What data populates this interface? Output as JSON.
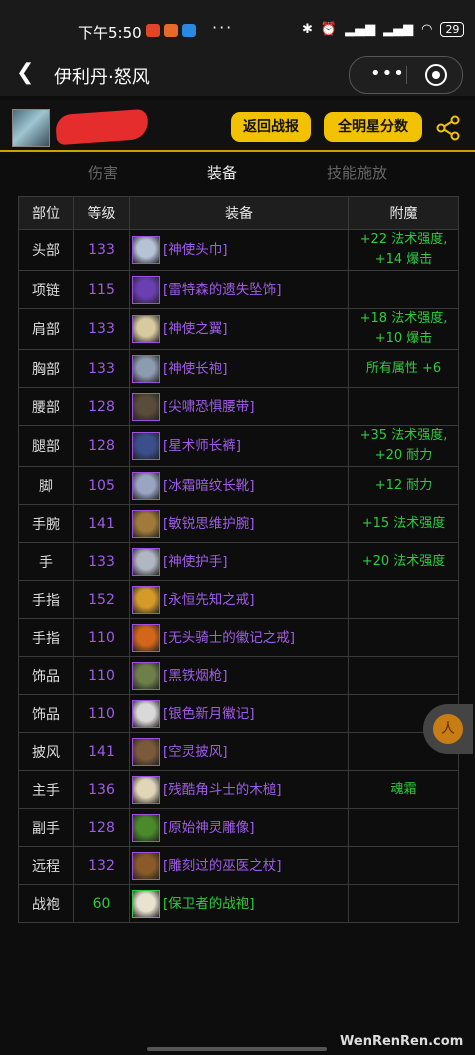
{
  "status": {
    "time": "下午5:50",
    "battery": "29"
  },
  "nav": {
    "title": "伊利丹·怒风",
    "more": "•••"
  },
  "header": {
    "btn_back": "返回战报",
    "btn_all": "全明星分数"
  },
  "tabs": {
    "damage": "伤害",
    "equip": "装备",
    "skill": "技能施放"
  },
  "table": {
    "headers": [
      "部位",
      "等级",
      "装备",
      "附魔"
    ],
    "rows": [
      {
        "slot": "头部",
        "level": "133",
        "item": "[神使头巾]",
        "ench": [
          "+22 法术强度,",
          "+14 爆击"
        ],
        "icon": "#b6c3d6"
      },
      {
        "slot": "项链",
        "level": "115",
        "item": "[雷特森的遗失坠饰]",
        "ench": [],
        "icon": "#6a3fb0"
      },
      {
        "slot": "肩部",
        "level": "133",
        "item": "[神使之翼]",
        "ench": [
          "+18 法术强度,",
          "+10 爆击"
        ],
        "icon": "#d8c9a0"
      },
      {
        "slot": "胸部",
        "level": "133",
        "item": "[神使长袍]",
        "ench": [
          "所有属性 +6"
        ],
        "icon": "#8c9bb0"
      },
      {
        "slot": "腰部",
        "level": "128",
        "item": "[尖啸恐惧腰带]",
        "ench": [],
        "icon": "#5a4c3a"
      },
      {
        "slot": "腿部",
        "level": "128",
        "item": "[星术师长裤]",
        "ench": [
          "+35 法术强度,",
          "+20 耐力"
        ],
        "icon": "#3b4f8c"
      },
      {
        "slot": "脚",
        "level": "105",
        "item": "[冰霜暗纹长靴]",
        "ench": [
          "+12 耐力"
        ],
        "icon": "#9aa5c4"
      },
      {
        "slot": "手腕",
        "level": "141",
        "item": "[敏锐思维护腕]",
        "ench": [
          "+15 法术强度"
        ],
        "icon": "#a07a3a"
      },
      {
        "slot": "手",
        "level": "133",
        "item": "[神使护手]",
        "ench": [
          "+20 法术强度"
        ],
        "icon": "#b0b6c2"
      },
      {
        "slot": "手指",
        "level": "152",
        "item": "[永恒先知之戒]",
        "ench": [],
        "icon": "#d49a2a"
      },
      {
        "slot": "手指",
        "level": "110",
        "item": "[无头骑士的徽记之戒]",
        "ench": [],
        "icon": "#d2661a"
      },
      {
        "slot": "饰品",
        "level": "110",
        "item": "[黑铁烟枪]",
        "ench": [],
        "icon": "#6e7f4a"
      },
      {
        "slot": "饰品",
        "level": "110",
        "item": "[银色新月徽记]",
        "ench": [],
        "icon": "#d9d9d9"
      },
      {
        "slot": "披风",
        "level": "141",
        "item": "[空灵披风]",
        "ench": [],
        "icon": "#7a5a3a"
      },
      {
        "slot": "主手",
        "level": "136",
        "item": "[残酷角斗士的木槌]",
        "ench": [
          "魂霜"
        ],
        "icon": "#e0d6b8"
      },
      {
        "slot": "副手",
        "level": "128",
        "item": "[原始神灵雕像]",
        "ench": [],
        "icon": "#4a8a2a"
      },
      {
        "slot": "远程",
        "level": "132",
        "item": "[雕刻过的巫医之杖]",
        "ench": [],
        "icon": "#8a5a2a"
      },
      {
        "slot": "战袍",
        "level": "60",
        "item": "[保卫者的战袍]",
        "ench": [],
        "icon": "#e8e2cf",
        "green": true
      }
    ]
  },
  "float": {
    "glyph": "⼈"
  },
  "watermark": "WenRenRen.com"
}
